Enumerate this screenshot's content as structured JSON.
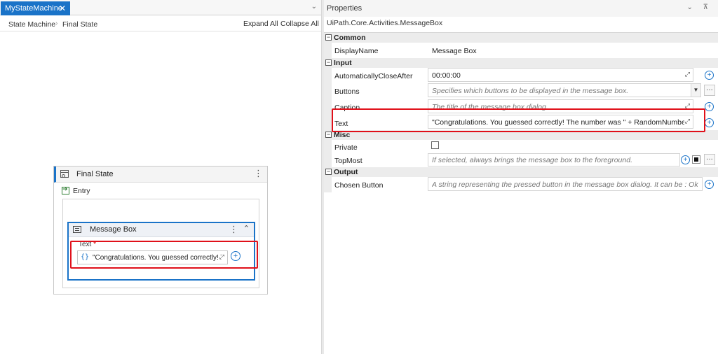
{
  "designer": {
    "tab_label": "MyStateMachine",
    "tab_close": "✕",
    "tab_overflow": "⌄",
    "breadcrumb": [
      "State Machine",
      "Final State"
    ],
    "breadcrumb_sep": "›",
    "expand_all": "Expand All",
    "collapse_all": "Collapse All",
    "state": {
      "title": "Final State",
      "entry_label": "Entry",
      "activity": {
        "title": "Message Box",
        "field_label": "Text",
        "required_mark": "*",
        "text_value": "\"Congratulations. You guessed correctly! The number was \" + RandomNumber + \".\""
      }
    }
  },
  "properties": {
    "panel_title": "Properties",
    "panel_controls": "⌄ ⊼",
    "activity_type": "UiPath.Core.Activities.MessageBox",
    "categories": [
      {
        "name": "Common",
        "props": [
          {
            "name": "DisplayName",
            "value": "Message Box"
          }
        ]
      },
      {
        "name": "Input",
        "props": [
          {
            "name": "AutomaticallyCloseAfter",
            "value": "00:00:00"
          },
          {
            "name": "Buttons",
            "placeholder": "Specifies which buttons to be displayed in the message box."
          },
          {
            "name": "Caption",
            "placeholder": "The title of the message box dialog."
          },
          {
            "name": "Text",
            "value": "\"Congratulations. You guessed correctly! The number was \" + RandomNumber + \".\""
          }
        ]
      },
      {
        "name": "Misc",
        "props": [
          {
            "name": "Private"
          },
          {
            "name": "TopMost",
            "placeholder": "If selected, always brings the message box to the foreground."
          }
        ]
      },
      {
        "name": "Output",
        "props": [
          {
            "name": "Chosen Button",
            "placeholder": "A string representing the pressed button in the message box dialog. It can be : Ok, Yes, No c"
          }
        ]
      }
    ]
  },
  "colors": {
    "accent": "#1a73c8",
    "highlight": "#e0101a"
  }
}
